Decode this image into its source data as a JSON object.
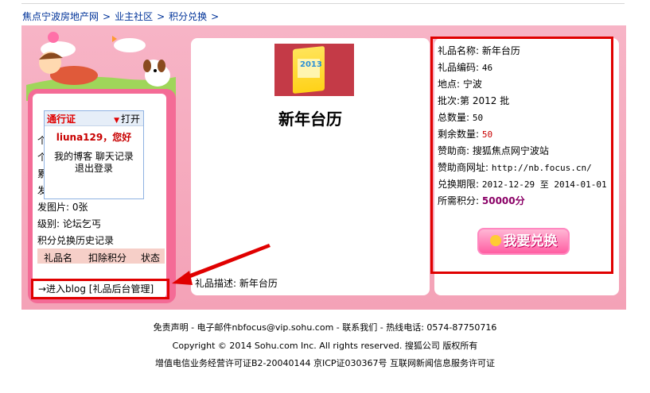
{
  "breadcrumb": {
    "items": [
      "焦点宁波房地产网",
      "业主社区",
      "积分兑换"
    ],
    "sep": ">"
  },
  "gift": {
    "title": "新年台历",
    "image_year": "2013",
    "description_label": "礼品描述:",
    "description": "新年台历"
  },
  "info": {
    "name_label": "礼品名称:",
    "name": "新年台历",
    "code_label": "礼品编码:",
    "code": "46",
    "location_label": "地点:",
    "location": "宁波",
    "batch_label": "批次:",
    "batch": "第 2012 批",
    "total_label": "总数量:",
    "total": "50",
    "remaining_label": "剩余数量:",
    "remaining": "50",
    "sponsor_label": "赞助商:",
    "sponsor": "搜狐焦点网宁波站",
    "sponsor_url_label": "赞助商网址:",
    "sponsor_url": "http://nb.focus.cn/",
    "period_label": "兑换期限:",
    "period": "2012-12-29 至 2014-01-01",
    "points_label": "所需积分:",
    "points": "50000分"
  },
  "redeem_button": "我要兑换",
  "passport": {
    "title": "通行证",
    "open": "打开",
    "user": "liuna129，您好",
    "links": [
      "我的博客",
      "聊天记录",
      "退出登录"
    ]
  },
  "left": {
    "partial_rows": [
      "个",
      "个",
      "累",
      "发"
    ],
    "photos": "发图片: 0张",
    "level": "级别: 论坛乞丐",
    "history": "积分兑换历史记录",
    "table_headers": [
      "礼品名",
      "扣除积分",
      "状态"
    ],
    "blog_link": "→进入blog [礼品后台管理]"
  },
  "footer": {
    "line1": "免责声明 - 电子邮件nbfocus@vip.sohu.com - 联系我们 - 热线电话: 0574-87750716",
    "line2": "Copyright © 2014 Sohu.com Inc. All rights reserved. 搜狐公司 版权所有",
    "line3": "增值电信业务经营许可证B2-20040144 京ICP证030367号 互联网新闻信息服务许可证"
  },
  "colors": {
    "highlight": "#e00000",
    "band": "#f6aabd",
    "panel": "#f46b96",
    "points": "#8a0066"
  }
}
